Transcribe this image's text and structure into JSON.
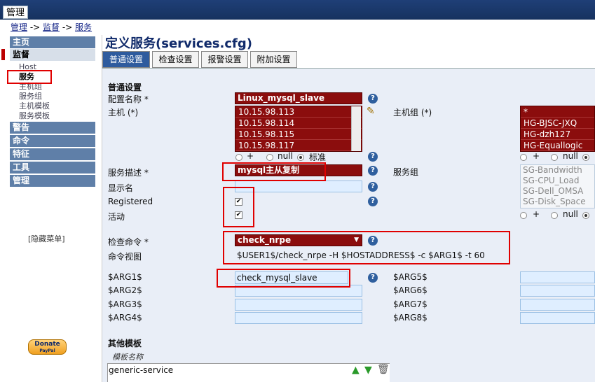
{
  "app_tab": "管理",
  "breadcrumb": {
    "a": "管理",
    "sep1": " -> ",
    "b": "监督",
    "sep2": " -> ",
    "c": "服务"
  },
  "nav": {
    "home": "主页",
    "monitor": "监督",
    "sub": [
      "Host",
      "服务",
      "主机组",
      "服务组",
      "主机模板",
      "服务模板"
    ],
    "alerts": "警告",
    "commands": "命令",
    "features": "特征",
    "tools": "工具",
    "admin": "管理",
    "hide_menu": "[隐藏菜单]",
    "donate": "Donate",
    "donate_sub": "PayPal"
  },
  "title": "定义服务(services.cfg)",
  "tabs": [
    "普通设置",
    "检查设置",
    "报警设置",
    "附加设置"
  ],
  "form": {
    "section_common": "普通设置",
    "config_name_label": "配置名称 *",
    "config_name_value": "Linux_mysql_slave",
    "host_label": "主机 (*)",
    "hosts": [
      "10.15.98.113",
      "10.15.98.114",
      "10.15.98.115",
      "10.15.98.117"
    ],
    "hostgroup_label": "主机组 (*)",
    "hostgroups": [
      "*",
      "HG-BJSC-JXQ",
      "HG-dzh127",
      "HG-Equallogic"
    ],
    "radio_plus": "+",
    "radio_null": "null",
    "radio_std": "标准",
    "desc_label": "服务描述 *",
    "desc_value": "mysql主从复制",
    "servicegroup_label": "服务组",
    "servicegroups": [
      "SG-Bandwidth",
      "SG-CPU_Load",
      "SG-Dell_OMSA",
      "SG-Disk_Space"
    ],
    "display_label": "显示名",
    "registered_label": "Registered",
    "active_label": "活动",
    "check_cmd_label": "检查命令 *",
    "check_cmd_value": "check_nrpe",
    "cmd_view_label": "命令视图",
    "cmd_view_value": "$USER1$/check_nrpe -H $HOSTADDRESS$ -c $ARG1$ -t 60",
    "args_left": [
      "$ARG1$",
      "$ARG2$",
      "$ARG3$",
      "$ARG4$"
    ],
    "args_right": [
      "$ARG5$",
      "$ARG6$",
      "$ARG7$",
      "$ARG8$"
    ],
    "arg1_value": "check_mysql_slave",
    "other_templates": "其他模板",
    "template_name_label": "模板名称",
    "template_value": "generic-service"
  },
  "colors": {
    "topbar": "#1f3f77",
    "nav_header": "#5f7fa8",
    "field_red": "#8b0d0d",
    "field_blue": "#dfeeff",
    "highlight": "#e00000"
  }
}
